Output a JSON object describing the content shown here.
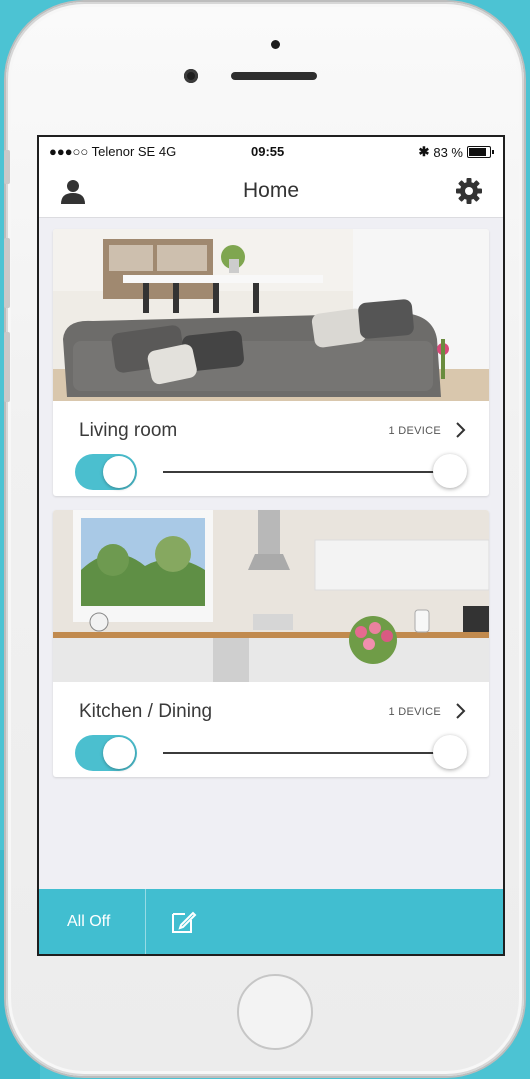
{
  "status_bar": {
    "carrier": "●●●○○ Telenor SE  4G",
    "time": "09:55",
    "battery": "83 %",
    "battery_level": 0.83
  },
  "navbar": {
    "title": "Home",
    "left_icon": "user-icon",
    "right_icon": "gear-icon"
  },
  "rooms": [
    {
      "name": "Living room",
      "device_count": "1 DEVICE",
      "on": true,
      "dim_level": 1.0,
      "photo": "living-room-photo"
    },
    {
      "name": "Kitchen / Dining",
      "device_count": "1 DEVICE",
      "on": true,
      "dim_level": 1.0,
      "photo": "kitchen-photo"
    }
  ],
  "bottom_bar": {
    "all_off_label": "All Off",
    "edit_icon": "edit-icon"
  },
  "colors": {
    "accent": "#41bed0",
    "background": "#efeff4",
    "page_bg": "#4cc3d3"
  }
}
